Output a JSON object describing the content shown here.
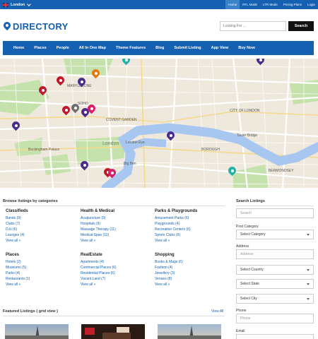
{
  "topbar": {
    "location": "London",
    "links": [
      "Home",
      "RTL Mode",
      "LTR Mode",
      "Pricing Plans",
      "Login"
    ]
  },
  "header": {
    "logo": "DIRECTORY",
    "search_placeholder": "Looking For ...",
    "search_button": "Search"
  },
  "nav": [
    "Home",
    "Places",
    "People",
    "All In One Map",
    "Theme Features",
    "Blog",
    "Submit Listing",
    "App View",
    "Buy Now"
  ],
  "categories": {
    "title": "Browse listings by categories",
    "view_all": "View all »",
    "groups": [
      {
        "name": "Classifieds",
        "items": [
          "Bands (9)",
          "Clubs (7)",
          "DJs (6)",
          "Lounges (4)"
        ]
      },
      {
        "name": "Health & Medical",
        "items": [
          "Acupuncture (9)",
          "Hospitals (9)",
          "Massage Therapy (11)",
          "Medical Spas (12)"
        ]
      },
      {
        "name": "Parks & Playgrounds",
        "items": [
          "Amusement Parks (6)",
          "Playgrounds (4)",
          "Recreation Centers (6)",
          "Sports Clubs (6)"
        ]
      },
      {
        "name": "Places",
        "items": [
          "Hotels (2)",
          "Museums (5)",
          "Parks (4)",
          "Restaurants (1)"
        ]
      },
      {
        "name": "RealEstate",
        "items": [
          "Apartments (4)",
          "Commercial Places (6)",
          "Residential Places (6)",
          "Vacant Land (7)"
        ]
      },
      {
        "name": "Shopping",
        "items": [
          "Books & Mags (6)",
          "Fashion (4)",
          "Jewellery (3)",
          "Venues (8)"
        ]
      }
    ]
  },
  "featured": {
    "title": "Featured Listings ( grid view )",
    "view_all": "View All"
  },
  "sidebar": {
    "title": "Search Listings",
    "search_placeholder": "Search",
    "post_category_label": "Post Category",
    "select_category": "Select Category",
    "address_label": "Address",
    "address_placeholder": "Address",
    "select_country": "Select Country",
    "select_state": "Select State",
    "select_city": "Select City",
    "phone_label": "Phone",
    "phone_placeholder": "Phone",
    "email_label": "Email"
  },
  "map": {
    "labels": [
      "MARYLEBONE",
      "London Eye",
      "COVENT GARDEN",
      "London",
      "Buckingham Palace",
      "BOROUGH",
      "CITY OF LONDON",
      "Tower Bridge",
      "SOHO",
      "Big Ben",
      "BERMONDSEY"
    ]
  },
  "colors": {
    "brand": "#1560b0",
    "water": "#a7c7f0",
    "park": "#c6e2ac",
    "marker_red": "#c0182c",
    "marker_purple": "#4b2c8a",
    "marker_pink": "#d6206a",
    "marker_gray": "#6e6e6e",
    "marker_orange": "#e07a14",
    "marker_teal": "#22b3a7"
  }
}
